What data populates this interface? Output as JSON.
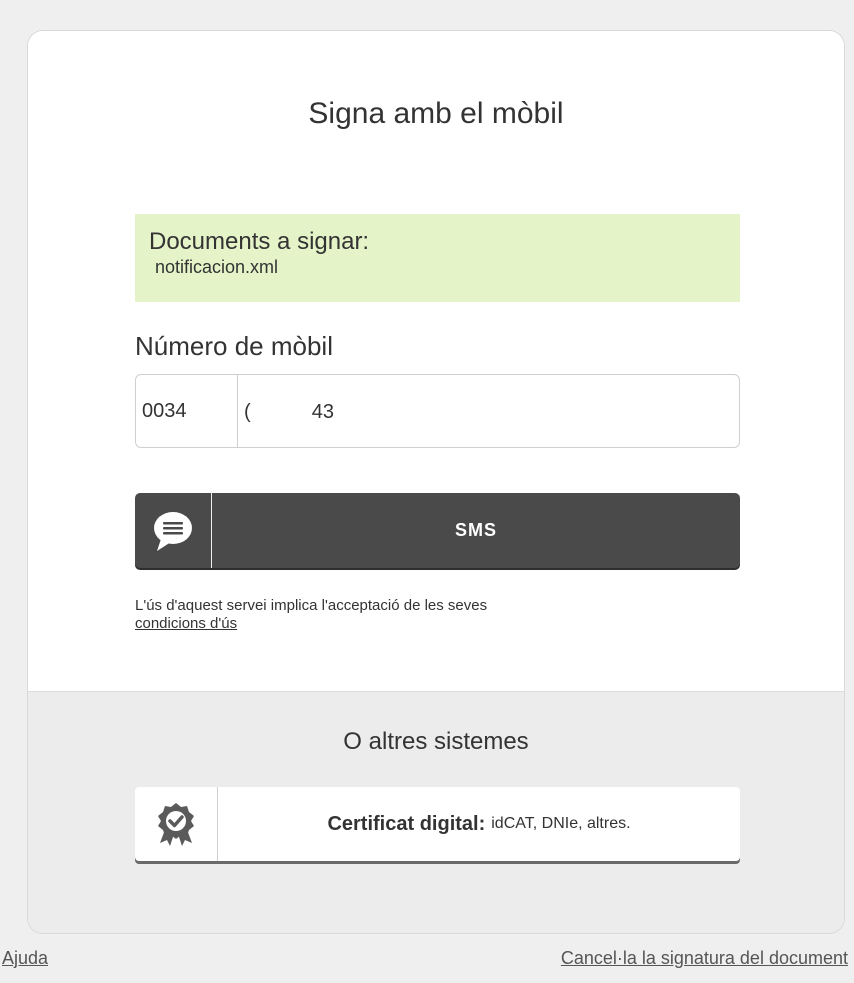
{
  "title": "Signa amb el mòbil",
  "documents": {
    "label": "Documents a signar:",
    "file": "notificacion.xml"
  },
  "mobile": {
    "label": "Número de mòbil",
    "prefix": "0034",
    "number": "(           43"
  },
  "sms_button": {
    "label": "SMS",
    "icon": "speech-bubble-icon"
  },
  "terms": {
    "text": "L'ús d'aquest servei implica l'acceptació de les seves",
    "link": "condicions d'ús"
  },
  "other_systems": {
    "title": "O altres sistemes",
    "cert_button": {
      "bold_label": "Certificat digital:",
      "detail": "idCAT, DNIe, altres.",
      "icon": "certificate-badge-icon"
    }
  },
  "footer": {
    "help": "Ajuda",
    "cancel": "Cancel·la la signatura del document"
  },
  "colors": {
    "background": "#efefef",
    "docs_box": "#e4f3c8",
    "sms_button": "#4a4a4a"
  }
}
